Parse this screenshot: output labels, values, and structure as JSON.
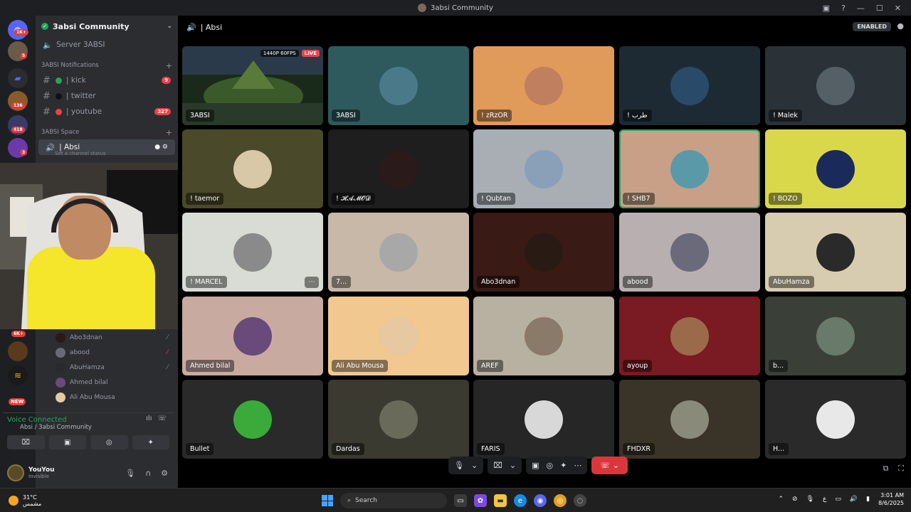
{
  "window": {
    "title": "3absi Community"
  },
  "guilds": {
    "badges": [
      "1K+",
      "5",
      "136",
      "418",
      "3",
      "6K+",
      "NEW"
    ]
  },
  "sidebar": {
    "server_name": "3absi Community",
    "server_sub": "Server 3ABSI",
    "cat1": "3ABSI Notifications",
    "channels": [
      {
        "label": "| kick",
        "color": "#23a55a",
        "badge": "9"
      },
      {
        "label": "| twitter",
        "color": "#111111",
        "badge": ""
      },
      {
        "label": "| youtube",
        "color": "#f23f43",
        "badge": "327"
      }
    ],
    "cat2": "3ABSI Space",
    "voice_channel": "| Absi",
    "channel_status": "Set a channel status",
    "voice_users": [
      "Abo3dnan",
      "abood",
      "AbuHamza",
      "Ahmed bilal",
      "Ali Abu Mousa"
    ],
    "voice_connected": "Voice Connected",
    "voice_path": "Absi / 3absi Community",
    "user": {
      "name": "YouYou",
      "status": "Invisible"
    }
  },
  "main": {
    "header": "| Absi",
    "enabled": "ENABLED",
    "stream": {
      "quality": "1440P 60FPS",
      "live": "LIVE"
    },
    "tiles": [
      {
        "name": "3ABSI",
        "bg": "#2d4a2a",
        "av": "",
        "stream": true
      },
      {
        "name": "3ABSI",
        "bg": "#2e5a5e",
        "av": "#4a7a8a"
      },
      {
        "name": "! zRzOR",
        "bg": "#e09a5a",
        "av": "#c08060"
      },
      {
        "name": "! طرب",
        "bg": "#1e2a33",
        "av": "#2a4a6a"
      },
      {
        "name": "! Malek",
        "bg": "#2a3238",
        "av": "#556066"
      },
      {
        "name": "! taemor",
        "bg": "#4a4a2a",
        "av": "#d8c8a8"
      },
      {
        "name": "! 𝓗𝓐𝓜𝓞𝓓",
        "bg": "#1e1e1e",
        "av": "#2a1a1a"
      },
      {
        "name": "! Qubtan",
        "bg": "#a8aeb4",
        "av": "#8aa0b8"
      },
      {
        "name": "! SHB7",
        "bg": "#c8a088",
        "av": "#5a9aa8",
        "speaking": true
      },
      {
        "name": "! BOZO",
        "bg": "#d8d84a",
        "av": "#1a2a5a"
      },
      {
        "name": "! MARCEL",
        "bg": "#d8dcd4",
        "av": "#8a8a8a",
        "more": true
      },
      {
        "name": "7...",
        "bg": "#c8b8a8",
        "av": "#a8a8a8"
      },
      {
        "name": "Abo3dnan",
        "bg": "#3a1a14",
        "av": "#2a1a14"
      },
      {
        "name": "abood",
        "bg": "#b8b0b0",
        "av": "#6a6a7a"
      },
      {
        "name": "AbuHamza",
        "bg": "#d8ccb0",
        "av": "#2a2a2a"
      },
      {
        "name": "Ahmed bilal",
        "bg": "#c8aaa0",
        "av": "#6a4a7a"
      },
      {
        "name": "Ali Abu Mousa",
        "bg": "#f0c890",
        "av": "#e8c8a0"
      },
      {
        "name": "AREF",
        "bg": "#b8b0a0",
        "av": "#8a7a6a"
      },
      {
        "name": "ayoup",
        "bg": "#7a1a22",
        "av": "#9a6a4a"
      },
      {
        "name": "b...",
        "bg": "#3a4038",
        "av": "#6a7a6a"
      },
      {
        "name": "Bullet",
        "bg": "#2a2a2a",
        "av": "#3aaa3a"
      },
      {
        "name": "Dardas",
        "bg": "#3a3a30",
        "av": "#6a6a5a"
      },
      {
        "name": "FARIS",
        "bg": "#262626",
        "av": "#d8d8d8"
      },
      {
        "name": "FHDXR",
        "bg": "#3a3428",
        "av": "#8a8a7a"
      },
      {
        "name": "H...",
        "bg": "#2a2a2a",
        "av": "#e8e8e8"
      }
    ]
  },
  "taskbar": {
    "temp": "31°C",
    "weather": "مشمس",
    "search": "Search",
    "lang": "ع",
    "time": "3:01 AM",
    "date": "8/6/2025"
  }
}
